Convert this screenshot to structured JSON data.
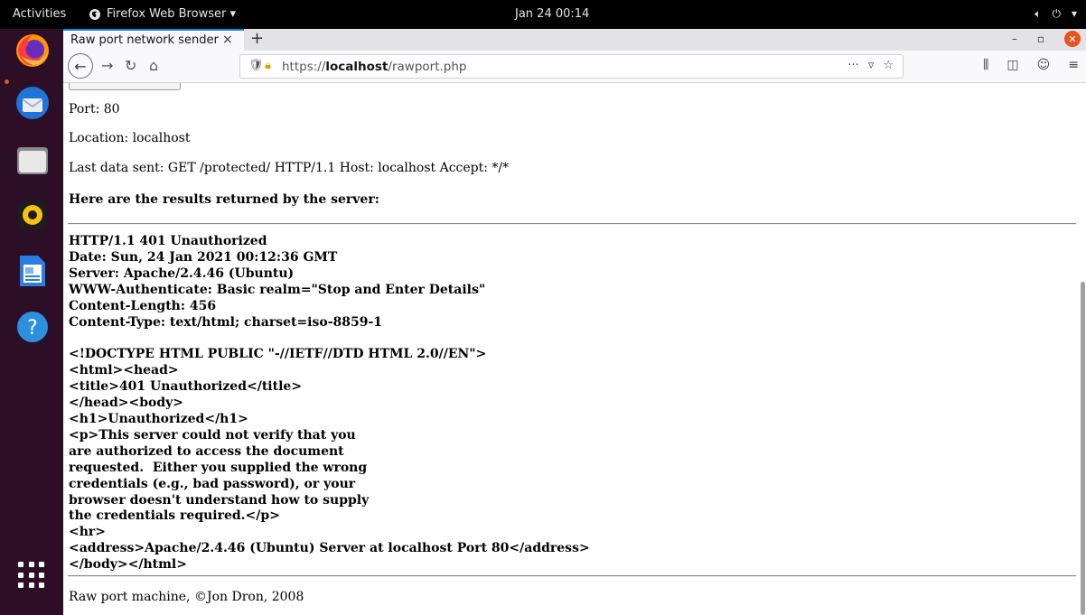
{
  "topbar": {
    "activities": "Activities",
    "app_name": "Firefox Web Browser ▾",
    "clock": "Jan 24  00:14",
    "tray_icons": [
      "volume-icon",
      "power-icon",
      "chevron-down-icon"
    ]
  },
  "dock": {
    "items": [
      "firefox-icon",
      "thunderbird-icon",
      "files-icon",
      "rhythmbox-icon",
      "libreoffice-writer-icon",
      "help-icon"
    ],
    "show_apps": "show-applications-icon"
  },
  "browser": {
    "tab_title": "Raw port network sender",
    "tab_close": "×",
    "new_tab": "+",
    "url_prefix": "https://",
    "url_host": "localhost",
    "url_path": "/rawport.php",
    "page_actions": "···",
    "accent": "#0a84ff"
  },
  "page": {
    "port_line": "Port: 80",
    "location_line": "Location: localhost",
    "last_data_line": "Last data sent: GET /protected/ HTTP/1.1 Host: localhost Accept: */*",
    "results_heading": "Here are the results returned by the server:",
    "response_lines": [
      "HTTP/1.1 401 Unauthorized",
      "Date: Sun, 24 Jan 2021 00:12:36 GMT",
      "Server: Apache/2.4.46 (Ubuntu)",
      "WWW-Authenticate: Basic realm=\"Stop and Enter Details\"",
      "Content-Length: 456",
      "Content-Type: text/html; charset=iso-8859-1",
      "",
      "<!DOCTYPE HTML PUBLIC \"-//IETF//DTD HTML 2.0//EN\">",
      "<html><head>",
      "<title>401 Unauthorized</title>",
      "</head><body>",
      "<h1>Unauthorized</h1>",
      "<p>This server could not verify that you",
      "are authorized to access the document",
      "requested.  Either you supplied the wrong",
      "credentials (e.g., bad password), or your",
      "browser doesn't understand how to supply",
      "the credentials required.</p>",
      "<hr>",
      "<address>Apache/2.4.46 (Ubuntu) Server at localhost Port 80</address>",
      "</body></html>"
    ],
    "footer": "Raw port machine, ©Jon Dron, 2008"
  }
}
